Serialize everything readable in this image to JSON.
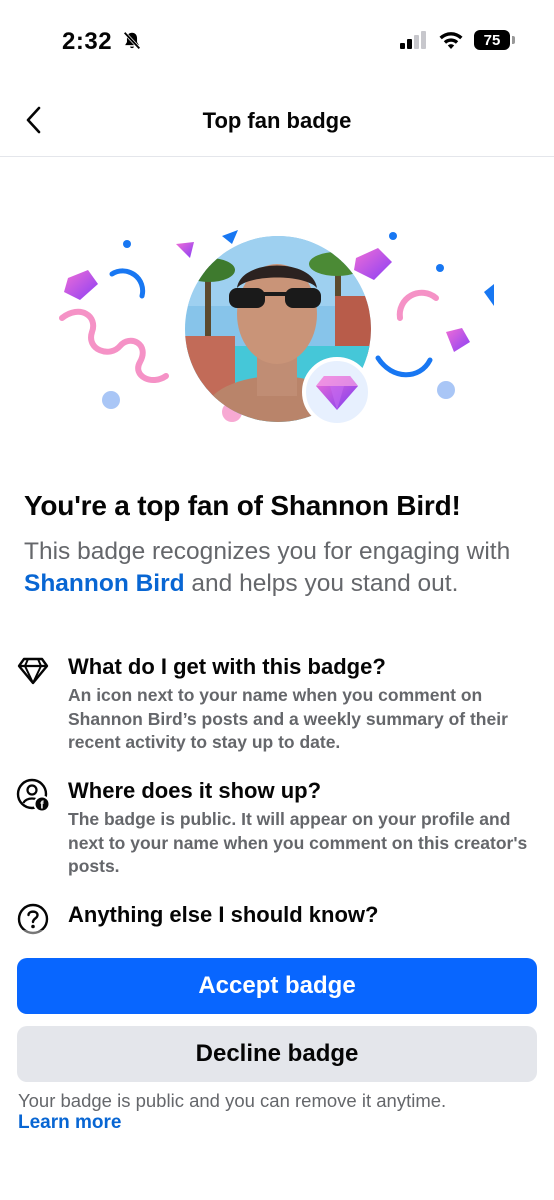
{
  "status": {
    "time": "2:32",
    "battery": "75"
  },
  "nav": {
    "title": "Top fan badge"
  },
  "content": {
    "headline": "You're a top fan of Shannon Bird!",
    "sub_before": "This badge recognizes you for engaging with ",
    "sub_link": "Shannon Bird",
    "sub_after": " and helps you stand out."
  },
  "faq": [
    {
      "icon": "diamond-icon",
      "title": "What do I get with this badge?",
      "body": "An icon next to your name when you comment on Shannon Bird’s posts and a weekly summary of their recent activity to stay up to date."
    },
    {
      "icon": "profile-facebook-icon",
      "title": "Where does it show up?",
      "body": "The badge is public. It will appear on your profile and next to your name when you comment on this creator's posts."
    },
    {
      "icon": "question-icon",
      "title": "Anything else I should know?",
      "body": ""
    }
  ],
  "actions": {
    "accept": "Accept badge",
    "decline": "Decline badge"
  },
  "footer": {
    "note": "Your badge is public and you can remove it anytime.",
    "learn_more": "Learn more"
  },
  "colors": {
    "primary": "#0866ff",
    "link": "#0866d3",
    "secondary_text": "#65676b",
    "decline_bg": "#e4e6eb"
  }
}
